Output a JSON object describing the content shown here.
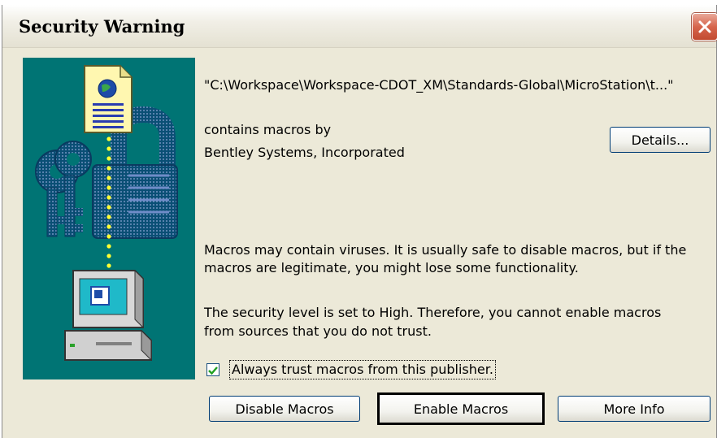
{
  "window": {
    "title": "Security Warning",
    "close_icon": "close-icon"
  },
  "dialog": {
    "file_path": "\"C:\\Workspace\\Workspace-CDOT_XM\\Standards-Global\\MicroStation\\t...\"",
    "contains_macros_by": "contains macros by",
    "publisher": "Bentley Systems, Incorporated",
    "warning_text_line1": "Macros may contain viruses. It is usually safe to disable macros, but if the",
    "warning_text_line2": "macros are legitimate, you might lose some functionality.",
    "security_text_line1": "The security level is set to High.  Therefore, you cannot enable macros",
    "security_text_line2": "from sources that you do not trust.",
    "trust_checkbox_label": "Always trust macros from this publisher.",
    "trust_checked": true
  },
  "buttons": {
    "details": "Details...",
    "disable_macros": "Disable Macros",
    "enable_macros": "Enable Macros",
    "more_info": "More Info"
  },
  "colors": {
    "illustration_bg": "#007474",
    "dialog_bg": "#ece9d8",
    "close_button": "#d6654c",
    "checkmark": "#21a121"
  }
}
